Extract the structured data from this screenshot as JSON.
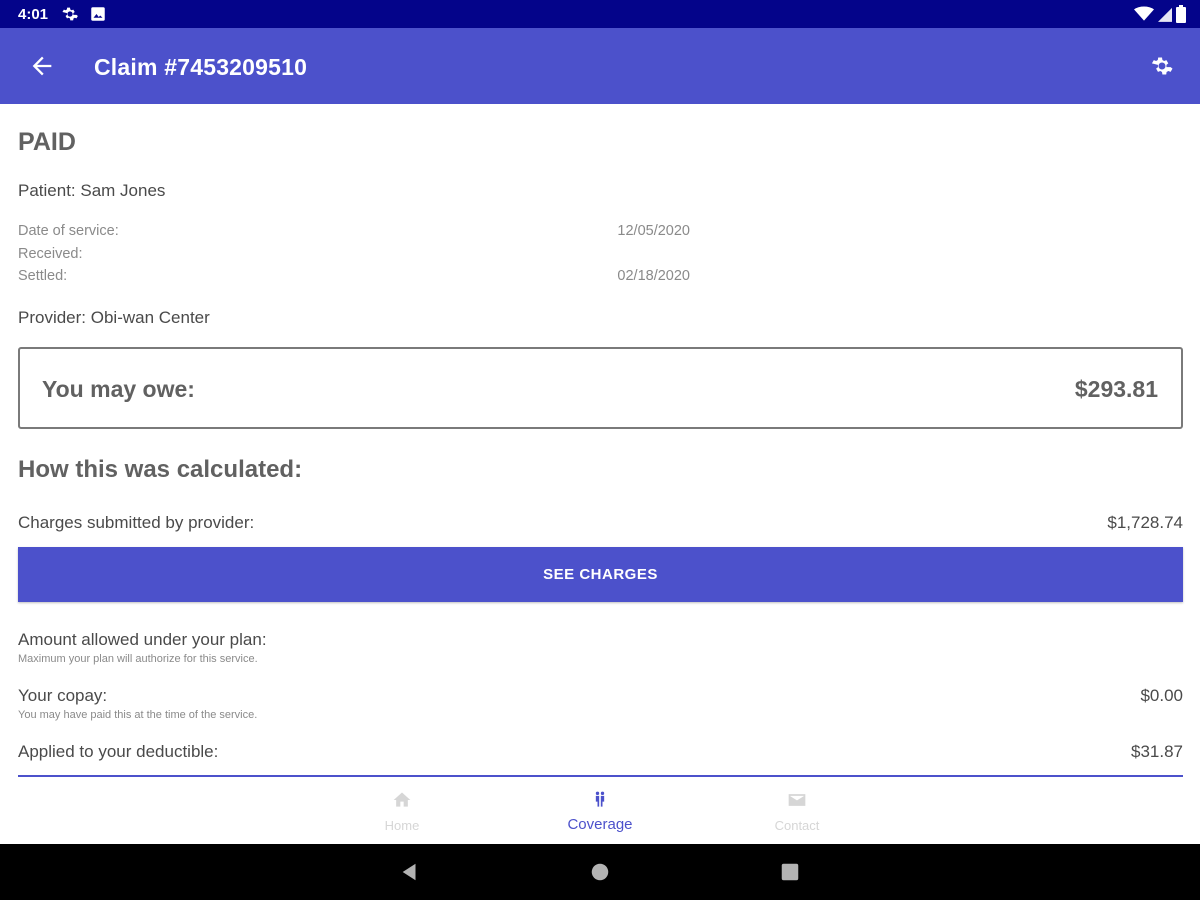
{
  "status_bar": {
    "time": "4:01",
    "icons": [
      "gear-icon",
      "image-icon",
      "wifi-icon",
      "signal-icon",
      "battery-icon"
    ]
  },
  "app_bar": {
    "title": "Claim #7453209510",
    "back_icon": "arrow-left-icon",
    "settings_icon": "gear-icon",
    "color": "#4c51cb"
  },
  "claim": {
    "status": "PAID",
    "patient": "Patient: Sam Jones",
    "dates": [
      {
        "label": "Date of service:",
        "value": "12/05/2020"
      },
      {
        "label": "Received:",
        "value": ""
      },
      {
        "label": "Settled:",
        "value": "02/18/2020"
      }
    ],
    "provider": "Provider: Obi-wan Center"
  },
  "owe": {
    "label": "You may owe:",
    "amount": "$293.81"
  },
  "calculation": {
    "heading": "How this was calculated:",
    "charges_label": "Charges submitted by provider:",
    "charges_value": "$1,728.74",
    "see_charges_button": "SEE CHARGES",
    "allowed_label": "Amount allowed under your plan:",
    "allowed_sub": "Maximum your plan will authorize for this service.",
    "copay_label": "Your copay:",
    "copay_sub": "You may have paid this at the time of the service.",
    "copay_value": "$0.00",
    "deductible_label": "Applied to your deductible:",
    "deductible_value": "$31.87"
  },
  "bottom_nav": {
    "items": [
      {
        "label": "Home",
        "icon": "home-icon",
        "active": false
      },
      {
        "label": "Coverage",
        "icon": "coverage-icon",
        "active": true
      },
      {
        "label": "Contact",
        "icon": "mail-icon",
        "active": false
      }
    ]
  },
  "system_nav": {
    "icons": [
      "back-triangle-icon",
      "home-circle-icon",
      "recents-square-icon"
    ]
  }
}
